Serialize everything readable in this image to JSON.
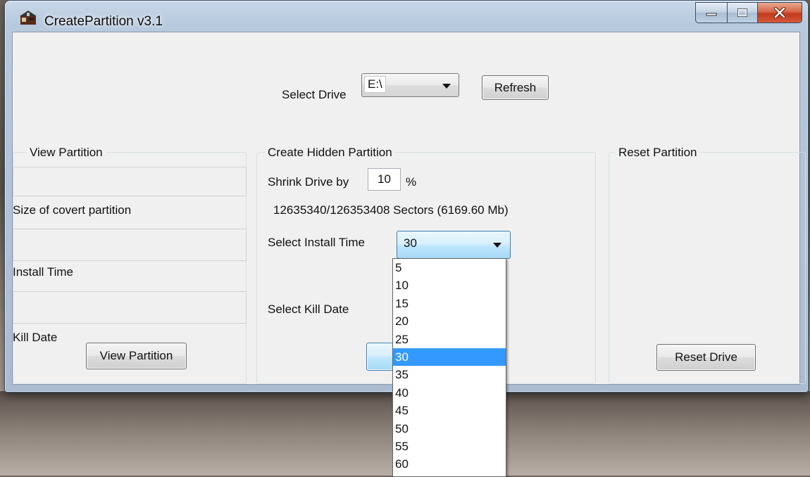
{
  "window": {
    "title": "CreatePartition v3.1"
  },
  "drive": {
    "label": "Select Drive",
    "value": "E:\\",
    "refresh_label": "Refresh"
  },
  "view_partition": {
    "title": "View Partition",
    "size_label": "Size of covert partition",
    "install_time_label": "Install Time",
    "kill_date_label": "Kill Date",
    "button_label": "View Partition"
  },
  "create_partition": {
    "title": "Create Hidden Partition",
    "shrink_label": "Shrink Drive by",
    "shrink_value": "10",
    "shrink_unit": "%",
    "sectors_text": "12635340/126353408 Sectors (6169.60 Mb)",
    "install_time_label": "Select Install Time",
    "install_time_value": "30",
    "kill_date_label": "Select Kill Date"
  },
  "reset_partition": {
    "title": "Reset Partition",
    "button_label": "Reset Drive"
  },
  "install_time_options": [
    "5",
    "10",
    "15",
    "20",
    "25",
    "30",
    "35",
    "40",
    "45",
    "50",
    "55",
    "60"
  ],
  "install_time_selected_index": 5
}
